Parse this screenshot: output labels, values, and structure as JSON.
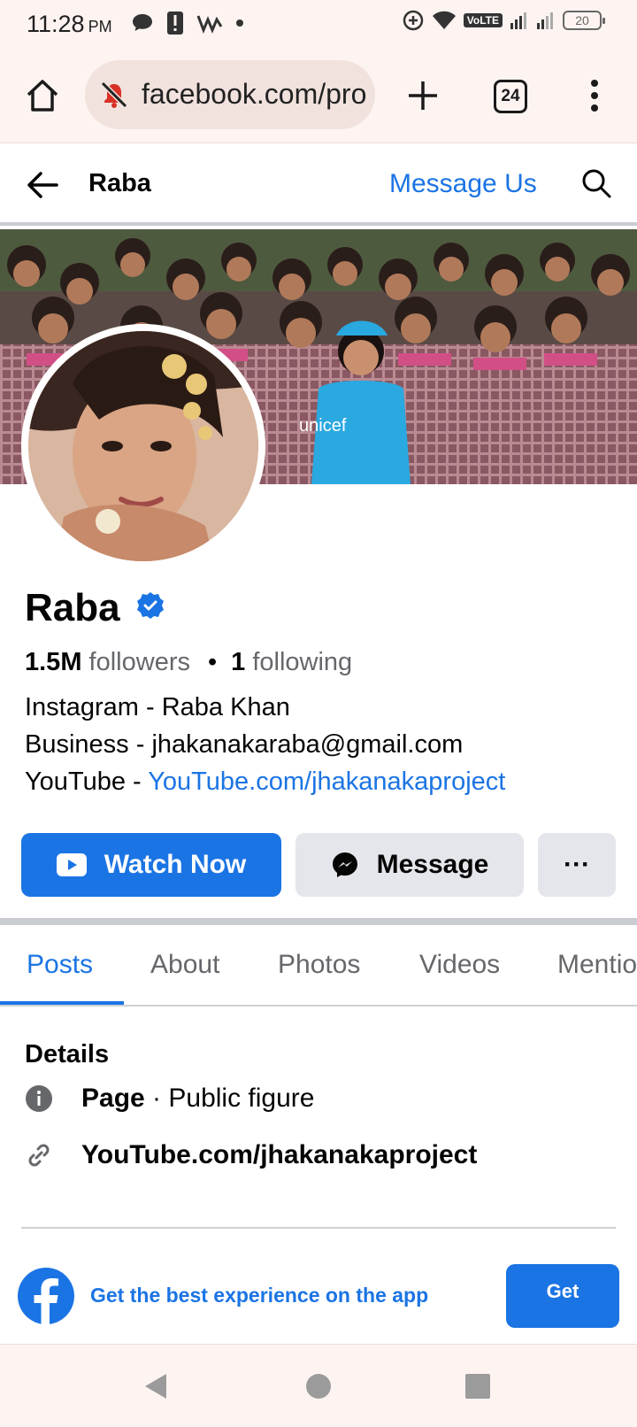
{
  "status_bar": {
    "time": "11:28",
    "ampm": "PM",
    "volte": "VoLTE",
    "battery": "20"
  },
  "browser": {
    "url": "facebook.com/pro",
    "tab_count": "24"
  },
  "header": {
    "title": "Raba",
    "message_us": "Message Us"
  },
  "cover": {
    "shirt_text": "unicef"
  },
  "profile": {
    "name": "Raba",
    "followers_count": "1.5M",
    "followers_label": "followers",
    "dot": "•",
    "following_count": "1",
    "following_label": "following",
    "bio_line1": "Instagram - Raba Khan",
    "bio_line2": "Business - jhakanakaraba@gmail.com",
    "bio_line3_prefix": "YouTube - ",
    "bio_line3_link": "YouTube.com/jhakanakaproject"
  },
  "actions": {
    "watch_now": "Watch Now",
    "message": "Message",
    "more": "···"
  },
  "tabs": [
    "Posts",
    "About",
    "Photos",
    "Videos",
    "Mentions"
  ],
  "details": {
    "title": "Details",
    "page_label": "Page",
    "page_separator": " · ",
    "page_category": "Public figure",
    "link": "YouTube.com/jhakanakaproject"
  },
  "app_banner": {
    "text": "Get the best experience on the app",
    "button": "Get"
  },
  "colors": {
    "accent": "#1b74e4",
    "secondary_text": "#65676b",
    "chrome_bg": "#fdf4f1"
  }
}
